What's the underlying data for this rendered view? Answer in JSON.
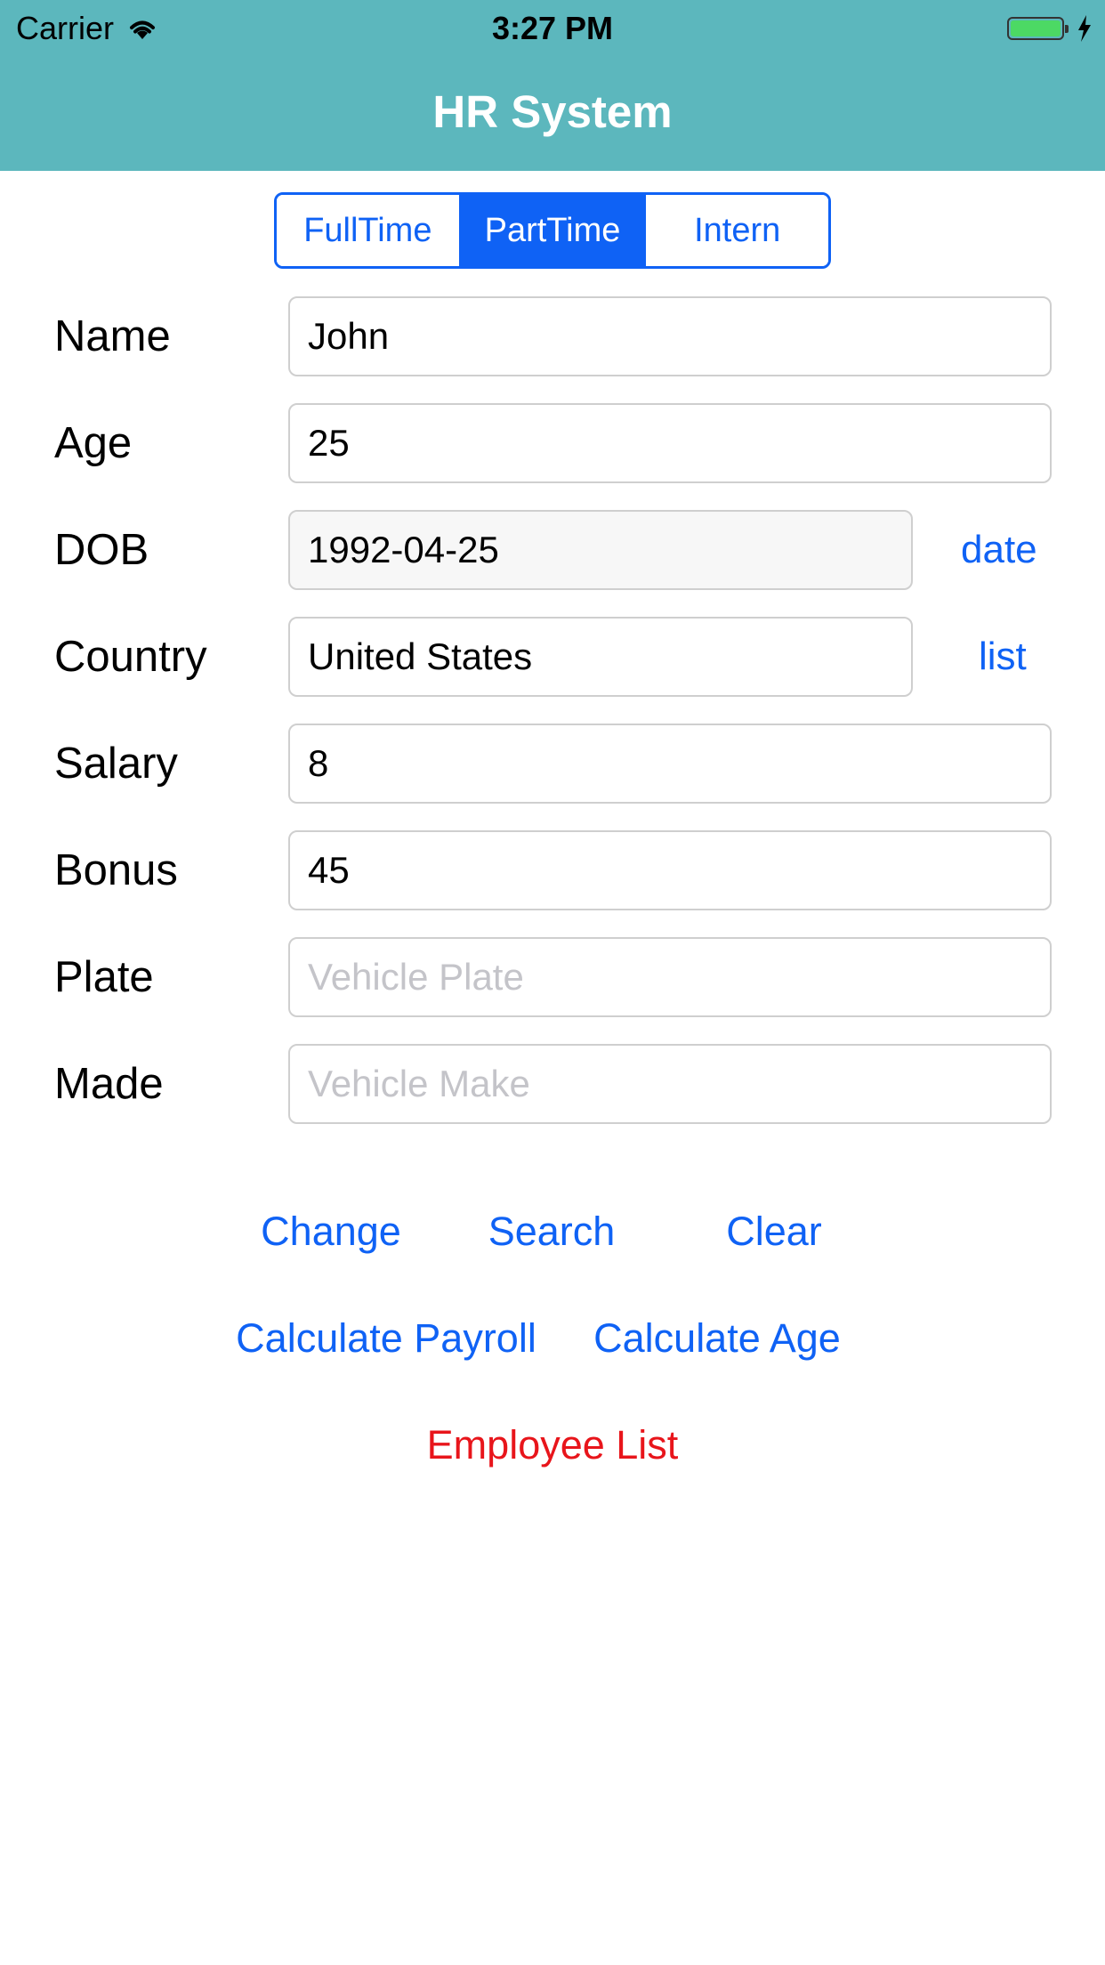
{
  "status_bar": {
    "carrier": "Carrier",
    "time": "3:27 PM",
    "battery_color": "#4cd964"
  },
  "nav": {
    "title": "HR System",
    "background": "#5cb7bd"
  },
  "segments": {
    "items": [
      "FullTime",
      "PartTime",
      "Intern"
    ],
    "selected": "PartTime",
    "accent": "#0f62f5"
  },
  "form": {
    "name": {
      "label": "Name",
      "value": "John"
    },
    "age": {
      "label": "Age",
      "value": "25"
    },
    "dob": {
      "label": "DOB",
      "value": "1992-04-25",
      "link": "date"
    },
    "country": {
      "label": "Country",
      "value": "United States",
      "link": "list"
    },
    "salary": {
      "label": "Salary",
      "value": "8"
    },
    "bonus": {
      "label": "Bonus",
      "value": "45"
    },
    "plate": {
      "label": "Plate",
      "value": "",
      "placeholder": "Vehicle Plate"
    },
    "made": {
      "label": "Made",
      "value": "",
      "placeholder": "Vehicle Make"
    }
  },
  "actions": {
    "change": "Change",
    "search": "Search",
    "clear": "Clear",
    "calculate_payroll": "Calculate Payroll",
    "calculate_age": "Calculate Age",
    "employee_list": "Employee List"
  }
}
